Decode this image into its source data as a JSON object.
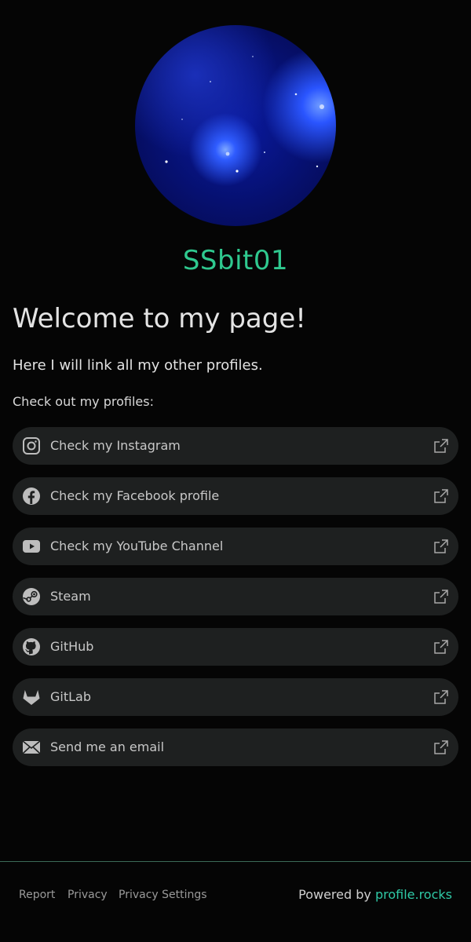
{
  "profile": {
    "username": "SSbit01",
    "welcome_heading": "Welcome to my page!",
    "intro_text": "Here I will link all my other profiles.",
    "links_heading": "Check out my profiles:"
  },
  "links": [
    {
      "label": "Check my Instagram",
      "icon": "instagram-icon"
    },
    {
      "label": "Check my Facebook profile",
      "icon": "facebook-icon"
    },
    {
      "label": "Check my YouTube Channel",
      "icon": "youtube-icon"
    },
    {
      "label": "Steam",
      "icon": "steam-icon"
    },
    {
      "label": "GitHub",
      "icon": "github-icon"
    },
    {
      "label": "GitLab",
      "icon": "gitlab-icon"
    },
    {
      "label": "Send me an email",
      "icon": "email-icon"
    }
  ],
  "footer": {
    "report": "Report",
    "privacy": "Privacy",
    "privacy_settings": "Privacy Settings",
    "powered_by": "Powered by",
    "brand": "profile.rocks"
  },
  "colors": {
    "background": "#050505",
    "accent_green": "#2fc98f",
    "link_bg": "#1e2020",
    "footer_line": "#3b6b57"
  }
}
